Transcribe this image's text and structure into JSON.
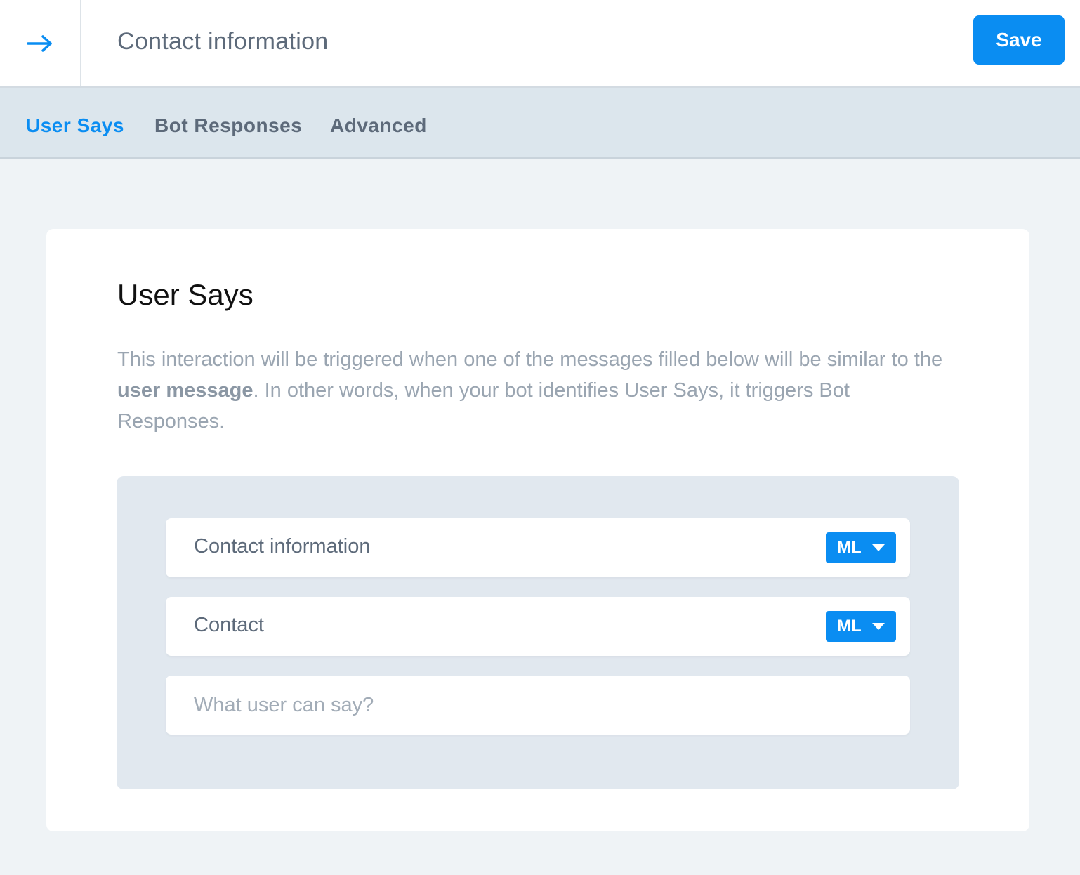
{
  "header": {
    "back_icon": "arrow-right-icon",
    "title": "Contact information",
    "save_label": "Save"
  },
  "tabs": [
    {
      "label": "User Says",
      "active": true
    },
    {
      "label": "Bot Responses",
      "active": false
    },
    {
      "label": "Advanced",
      "active": false
    }
  ],
  "card": {
    "title": "User Says",
    "desc_part1": "This interaction will be triggered when one of the messages filled below will be similar to the ",
    "desc_bold": "user message",
    "desc_part2": ". In other words, when your bot identifies User Says, it triggers Bot Responses."
  },
  "user_says": {
    "items": [
      {
        "text": "Contact information",
        "mode": "ML"
      },
      {
        "text": "Contact",
        "mode": "ML"
      }
    ],
    "input_placeholder": "What user can say?"
  },
  "colors": {
    "accent": "#0a8df2",
    "header_bg": "#ffffff",
    "tabs_bg": "#dce6ed",
    "page_bg": "#eff3f6",
    "panel_bg": "#e1e8ef"
  }
}
